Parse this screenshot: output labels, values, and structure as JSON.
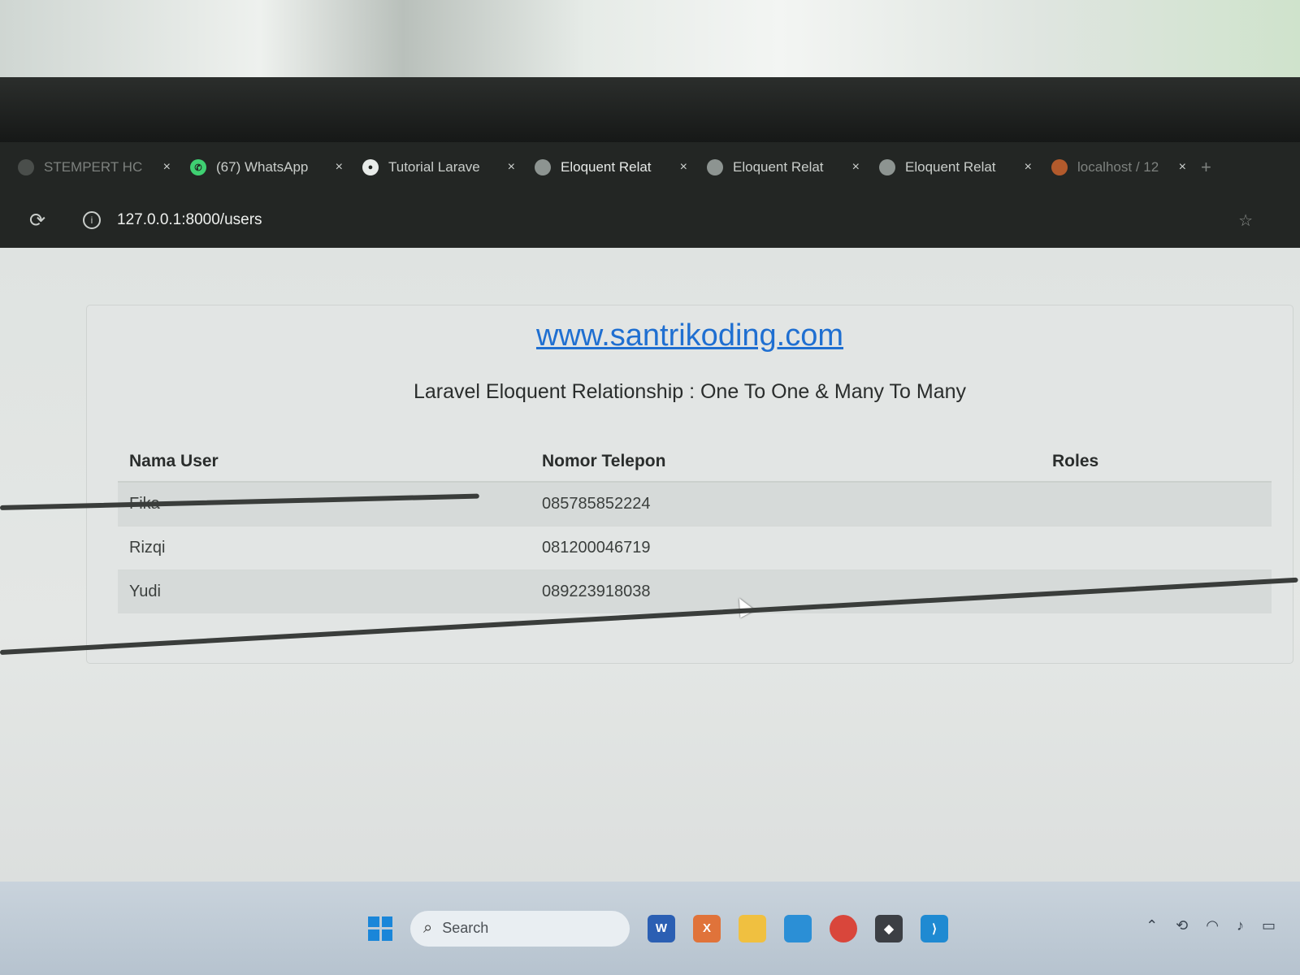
{
  "browser": {
    "tabs": [
      {
        "label": "STEMPERT HC",
        "icon": "page-icon",
        "close": "×",
        "state": "dim"
      },
      {
        "label": "(67) WhatsApp",
        "icon": "whatsapp-icon",
        "close": "×",
        "state": "normal"
      },
      {
        "label": "Tutorial Larave",
        "icon": "tutorial-icon",
        "close": "×",
        "state": "normal"
      },
      {
        "label": "Eloquent Relat",
        "icon": "globe-icon",
        "close": "×",
        "state": "active"
      },
      {
        "label": "Eloquent Relat",
        "icon": "globe-icon",
        "close": "×",
        "state": "normal"
      },
      {
        "label": "Eloquent Relat",
        "icon": "globe-icon",
        "close": "×",
        "state": "normal"
      },
      {
        "label": "localhost / 12",
        "icon": "phpmyadmin-icon",
        "close": "×",
        "state": "dim"
      }
    ],
    "new_tab": "+",
    "url": "127.0.0.1:8000/users"
  },
  "page": {
    "site_link": "www.santrikoding.com",
    "subtitle": "Laravel Eloquent Relationship : One To One & Many To Many",
    "table": {
      "headers": [
        "Nama User",
        "Nomor Telepon",
        "Roles"
      ],
      "rows": [
        {
          "name": "Fika",
          "phone": "085785852224",
          "roles": ""
        },
        {
          "name": "Rizqi",
          "phone": "081200046719",
          "roles": ""
        },
        {
          "name": "Yudi",
          "phone": "089223918038",
          "roles": ""
        }
      ]
    }
  },
  "taskbar": {
    "search_label": "Search",
    "apps": [
      "word-icon",
      "xampp-icon",
      "file-explorer-icon",
      "store-icon",
      "chrome-icon",
      "git-icon",
      "vscode-icon"
    ],
    "colors": {
      "accent": "#1f6fd1",
      "start": "#1a86d9"
    }
  }
}
